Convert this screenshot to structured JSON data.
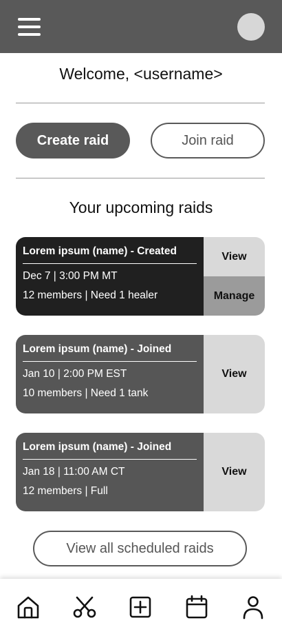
{
  "header": {
    "menu_icon": "hamburger-menu-icon",
    "avatar_icon": "user-avatar"
  },
  "welcome": {
    "text": "Welcome, <username>"
  },
  "actions": {
    "create_label": "Create raid",
    "join_label": "Join raid"
  },
  "upcoming": {
    "title": "Your upcoming raids",
    "raids": [
      {
        "title": "Lorem ipsum (name) - Created",
        "datetime": "Dec 7 | 3:00 PM MT",
        "details": "12 members | Need 1 healer",
        "view_label": "View",
        "manage_label": "Manage"
      },
      {
        "title": "Lorem ipsum (name) - Joined",
        "datetime": "Jan 10 | 2:00 PM EST",
        "details": "10 members | Need 1 tank",
        "view_label": "View"
      },
      {
        "title": "Lorem ipsum (name) - Joined",
        "datetime": "Jan 18 | 11:00 AM CT",
        "details": "12 members | Full",
        "view_label": "View"
      }
    ],
    "view_all_label": "View all scheduled raids"
  },
  "bottom_nav": {
    "items": [
      {
        "icon": "home-icon"
      },
      {
        "icon": "scissors-icon"
      },
      {
        "icon": "add-square-icon"
      },
      {
        "icon": "calendar-icon"
      },
      {
        "icon": "profile-icon"
      }
    ]
  },
  "colors": {
    "header_bg": "#595959",
    "card_dark": "#202020",
    "card_mid": "#565656",
    "action_light": "#d9d9d9",
    "action_mid": "#9b9b9b",
    "avatar": "#d7d7d7"
  }
}
